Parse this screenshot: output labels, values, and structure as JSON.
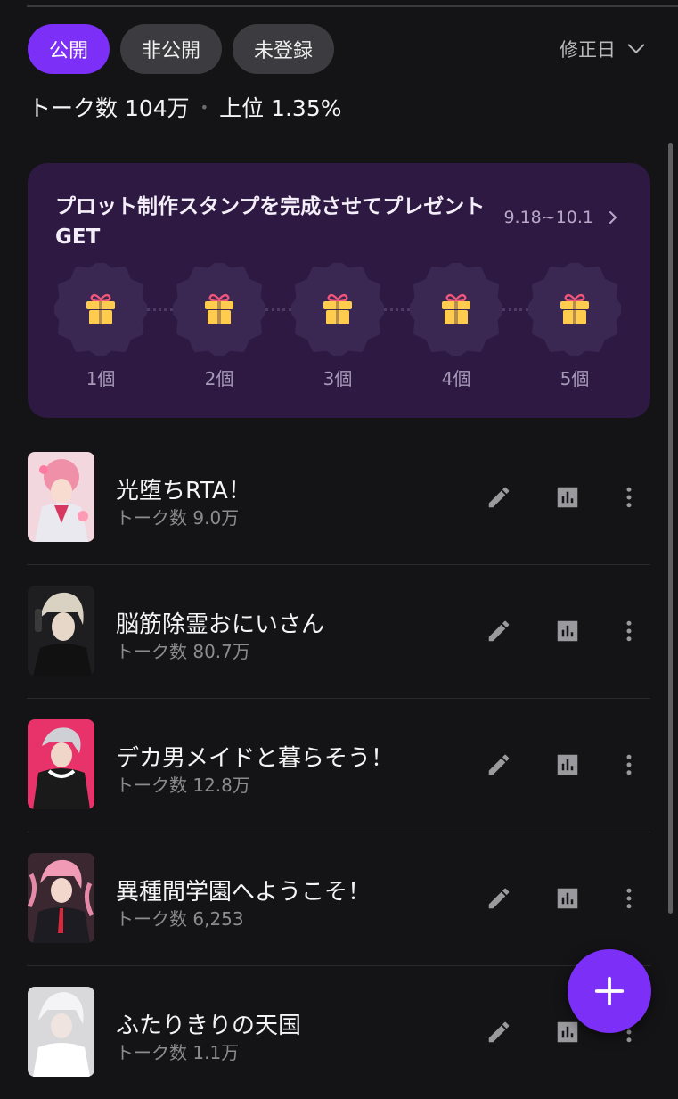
{
  "filters": [
    {
      "label": "公開",
      "active": true
    },
    {
      "label": "非公開",
      "active": false
    },
    {
      "label": "未登録",
      "active": false
    }
  ],
  "sort": {
    "label": "修正日",
    "icon": "chevron-down-icon"
  },
  "stats": {
    "talks": "トーク数 104万",
    "rank": "上位 1.35%"
  },
  "banner": {
    "title": "プロット制作スタンプを完成させてプレゼントGET",
    "period": "9.18~10.1",
    "stamps": [
      "1個",
      "2個",
      "3個",
      "4個",
      "5個"
    ]
  },
  "stories": [
    {
      "title": "光堕ちRTA！",
      "talks": "トーク数 9.0万"
    },
    {
      "title": "脳筋除霊おにいさん",
      "talks": "トーク数 80.7万"
    },
    {
      "title": "デカ男メイドと暮らそう！",
      "talks": "トーク数 12.8万"
    },
    {
      "title": "異種間学園へようこそ！",
      "talks": "トーク数 6,253"
    },
    {
      "title": "ふたりきりの天国",
      "talks": "トーク数 1.1万"
    }
  ],
  "colors": {
    "accent": "#7b2ff7",
    "banner_bg": "#2d1942",
    "gift": "#ffcc4d",
    "ribbon": "#f0557a"
  }
}
